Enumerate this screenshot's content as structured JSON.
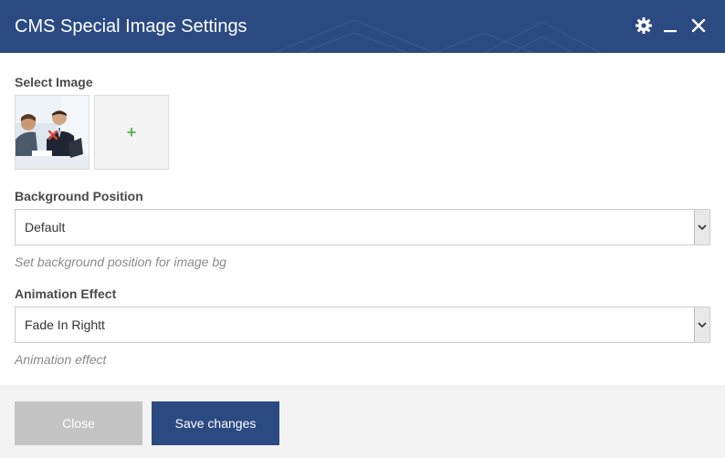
{
  "dialog": {
    "title": "CMS Special Image Settings",
    "icons": [
      "gear-icon",
      "minimize-icon",
      "close-icon"
    ]
  },
  "select_image": {
    "label": "Select Image",
    "add_symbol": "+"
  },
  "background_position": {
    "label": "Background Position",
    "value": "Default",
    "help": "Set background position for image bg"
  },
  "animation_effect": {
    "label": "Animation Effect",
    "value": "Fade In Rightt",
    "help": "Animation effect"
  },
  "footer": {
    "close_label": "Close",
    "save_label": "Save changes"
  },
  "colors": {
    "header_bg": "#2b4a82",
    "save_button": "#2b4a82",
    "close_button": "#c4c4c4",
    "add_plus": "#5cb85c",
    "remove_x": "#e0413a"
  }
}
